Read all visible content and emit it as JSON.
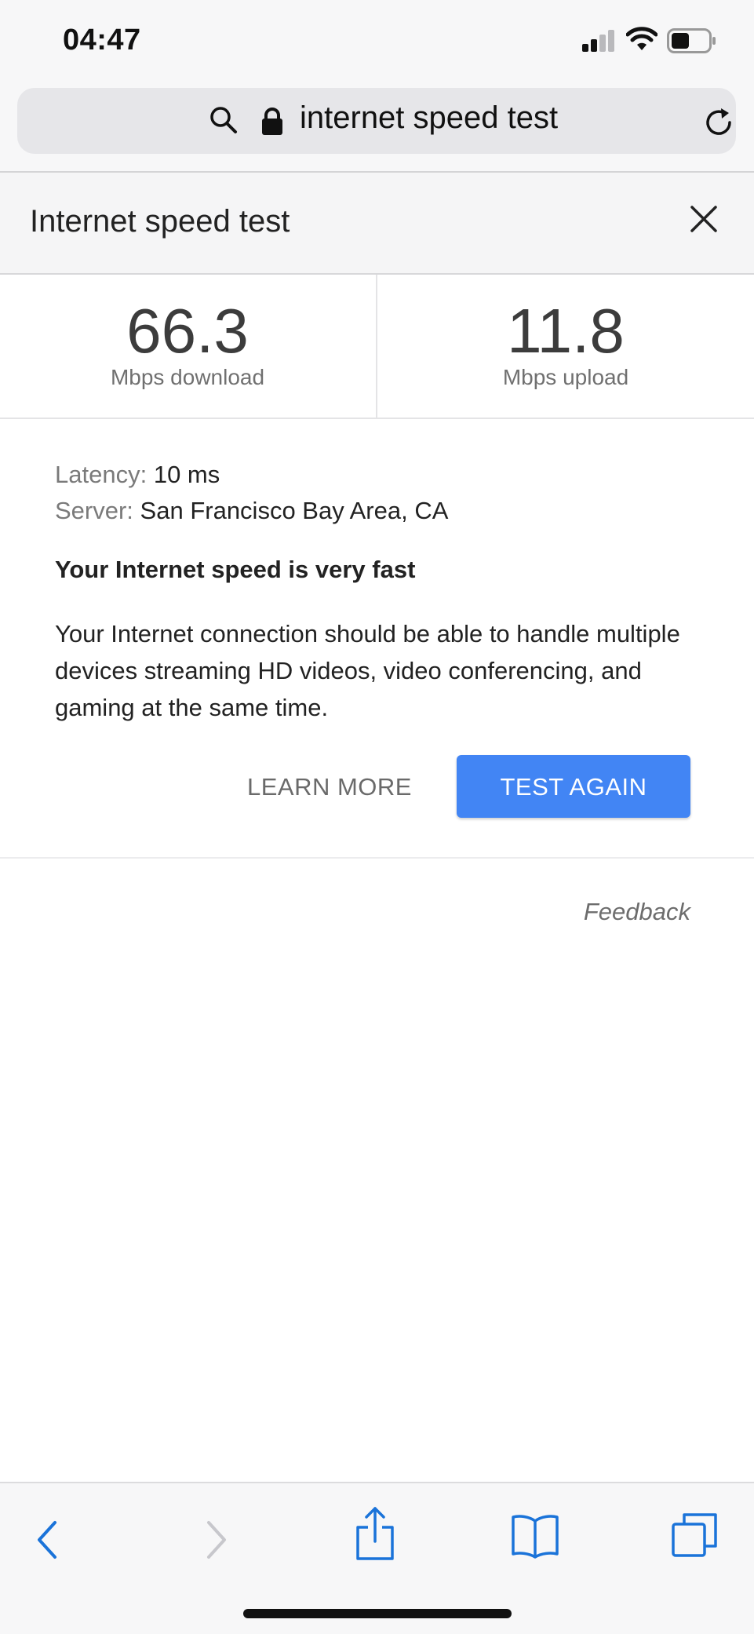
{
  "status_bar": {
    "time": "04:47"
  },
  "url_bar": {
    "text": "internet speed test",
    "icons": [
      "search-icon",
      "lock-icon",
      "reload-icon"
    ]
  },
  "card": {
    "title": "Internet speed test",
    "close_icon": "close-icon"
  },
  "metrics": {
    "download": {
      "value": "66.3",
      "unit": "Mbps download"
    },
    "upload": {
      "value": "11.8",
      "unit": "Mbps upload"
    }
  },
  "details": {
    "latency_label": "Latency:",
    "latency_value": "10 ms",
    "server_label": "Server:",
    "server_value": "San Francisco Bay Area, CA",
    "headline": "Your Internet speed is very fast",
    "description": "Your Internet connection should be able to handle multiple devices streaming HD videos, video conferencing, and gaming at the same time."
  },
  "actions": {
    "learn_more": "LEARN MORE",
    "test_again": "TEST AGAIN"
  },
  "feedback": "Feedback",
  "toolbar": {
    "icons": [
      "back-icon",
      "forward-icon",
      "share-icon",
      "bookmarks-icon",
      "tabs-icon"
    ]
  },
  "colors": {
    "accent": "#4285f4",
    "ios_blue": "#1a73d9",
    "disabled": "#c7c7cc"
  }
}
